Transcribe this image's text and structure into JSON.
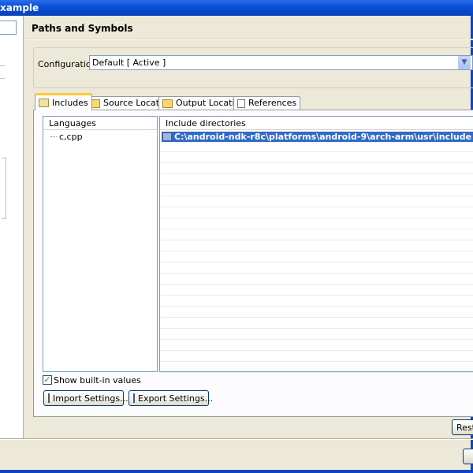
{
  "window": {
    "title": "xample"
  },
  "page": {
    "title": "Paths and Symbols"
  },
  "configuration": {
    "label": "Configuration:",
    "value": "Default  [ Active ]"
  },
  "tabs": [
    {
      "label": "Includes",
      "icon": "includes-icon",
      "active": true
    },
    {
      "label": "Source Location",
      "icon": "source-folder-icon",
      "active": false
    },
    {
      "label": "Output Location",
      "icon": "output-folder-icon",
      "active": false
    },
    {
      "label": "References",
      "icon": "references-icon",
      "active": false
    }
  ],
  "languages": {
    "header": "Languages",
    "items": [
      "c,cpp"
    ]
  },
  "include_directories": {
    "header": "Include directories",
    "items": [
      "C:\\android-ndk-r8c\\platforms\\android-9\\arch-arm\\usr\\include"
    ]
  },
  "show_builtin": {
    "label": "Show built-in values",
    "checked": true
  },
  "buttons": {
    "import": "Import Settings...",
    "export": "Export Settings...",
    "restore": "Resto"
  },
  "colors": {
    "selection": "#316ac5",
    "titlebar": "#0846c8",
    "dialog_bg": "#ece9d8"
  }
}
